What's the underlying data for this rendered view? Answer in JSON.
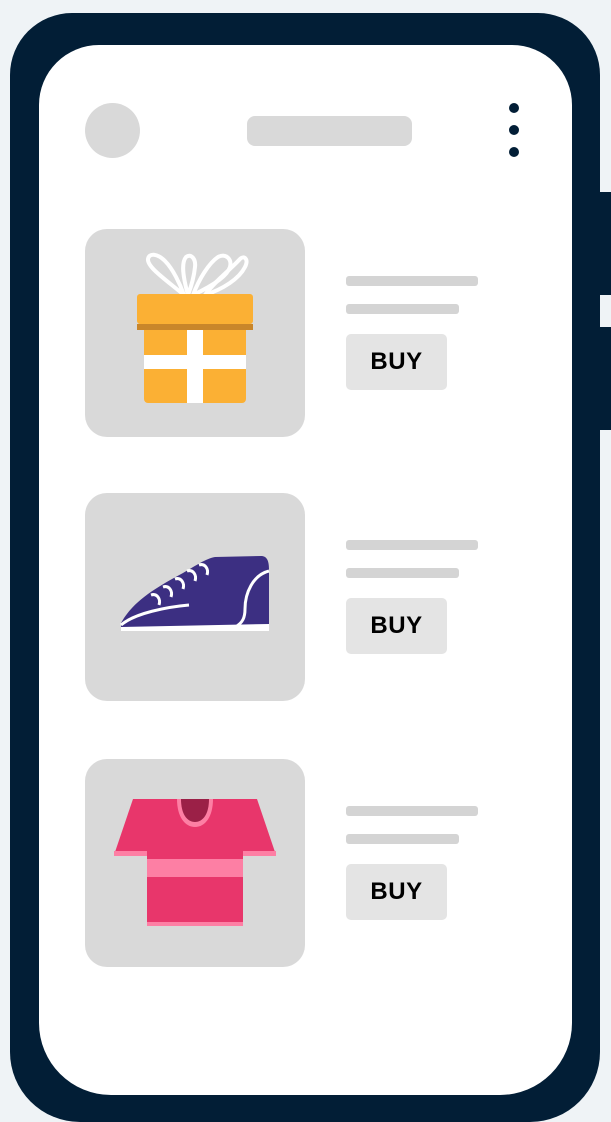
{
  "colors": {
    "background": "#eff3f6",
    "phone_frame": "#021e36",
    "screen": "#ffffff",
    "placeholder": "#d9d9d9",
    "button": "#e4e4e4",
    "gift": "#fbb034",
    "shoe": "#3c2f82",
    "shirt": "#e8366b"
  },
  "header": {
    "avatar_icon": "avatar-placeholder",
    "title_icon": "title-placeholder",
    "menu_icon": "kebab-menu-icon"
  },
  "products": [
    {
      "icon": "gift-box-icon",
      "buy_label": "BUY"
    },
    {
      "icon": "sneaker-icon",
      "buy_label": "BUY"
    },
    {
      "icon": "t-shirt-icon",
      "buy_label": "BUY"
    }
  ]
}
